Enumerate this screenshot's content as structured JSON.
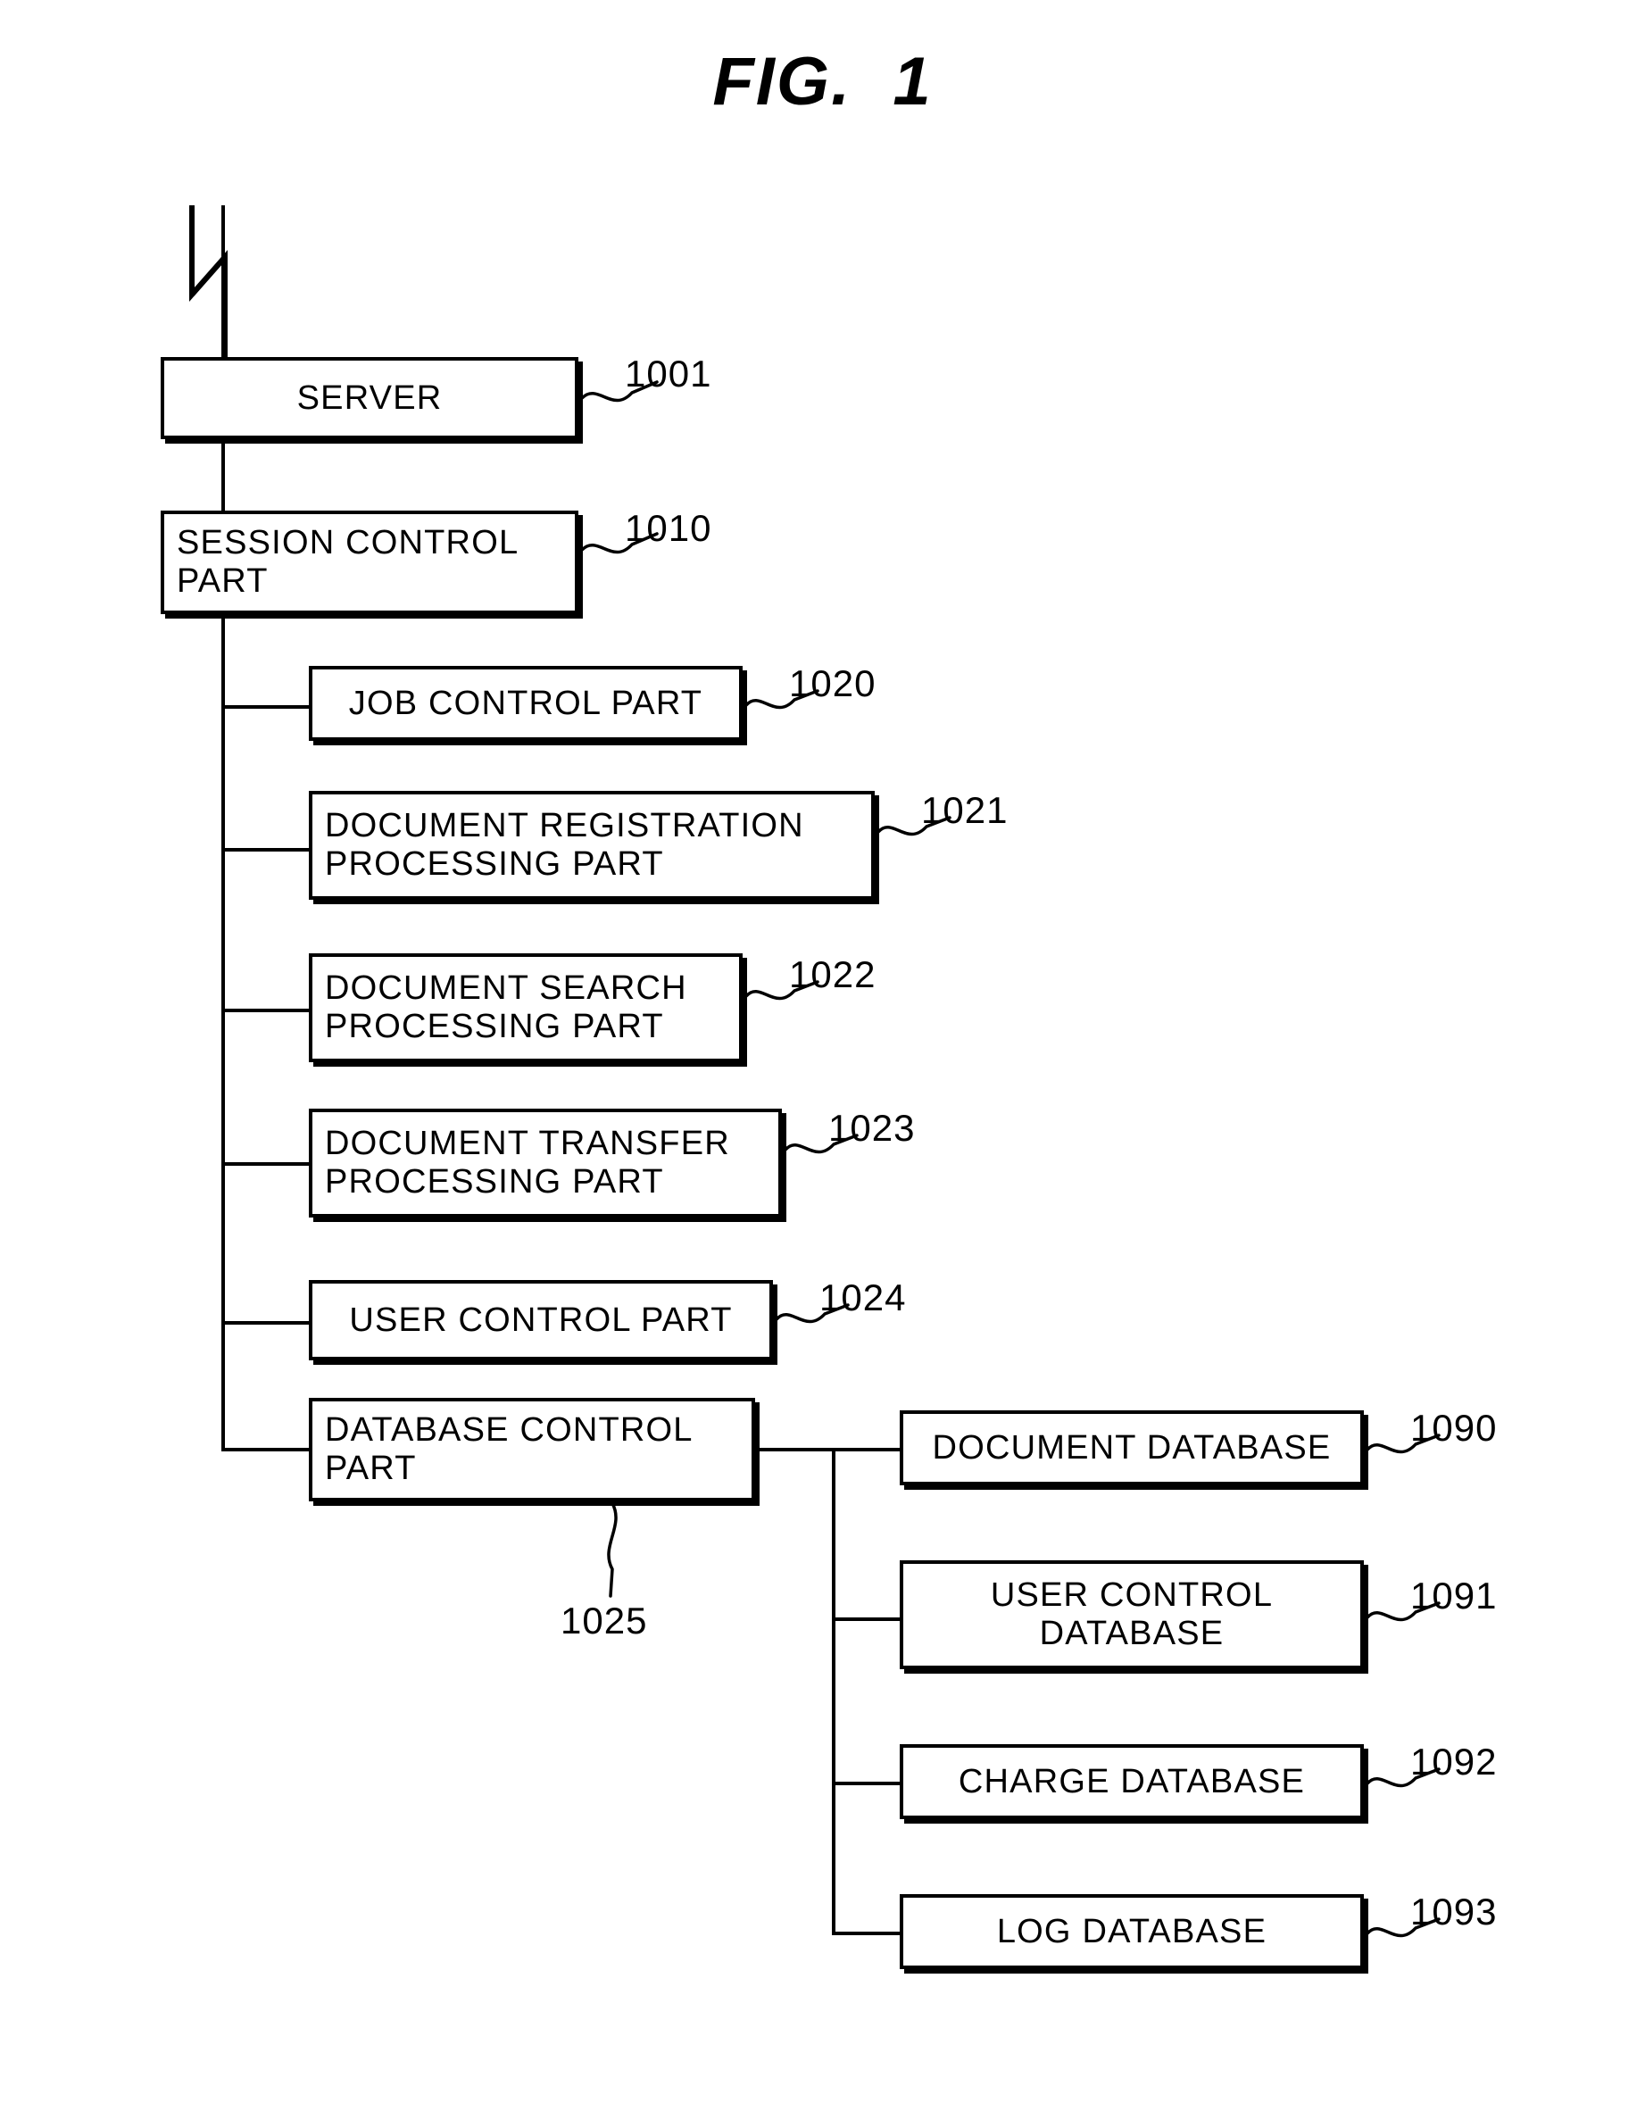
{
  "figure": {
    "title": "FIG.  1"
  },
  "nodes": {
    "server": {
      "label": "SERVER",
      "ref": "1001"
    },
    "session_control": {
      "label": "SESSION CONTROL\nPART",
      "ref": "1010"
    },
    "job_control": {
      "label": "JOB CONTROL PART",
      "ref": "1020"
    },
    "doc_registration": {
      "label": "DOCUMENT REGISTRATION\nPROCESSING PART",
      "ref": "1021"
    },
    "doc_search": {
      "label": "DOCUMENT SEARCH\nPROCESSING PART",
      "ref": "1022"
    },
    "doc_transfer": {
      "label": "DOCUMENT TRANSFER\nPROCESSING PART",
      "ref": "1023"
    },
    "user_control": {
      "label": "USER CONTROL PART",
      "ref": "1024"
    },
    "database_control": {
      "label": "DATABASE CONTROL\nPART",
      "ref": "1025"
    },
    "document_database": {
      "label": "DOCUMENT DATABASE",
      "ref": "1090"
    },
    "user_control_database": {
      "label": "USER CONTROL\nDATABASE",
      "ref": "1091"
    },
    "charge_database": {
      "label": "CHARGE DATABASE",
      "ref": "1092"
    },
    "log_database": {
      "label": "LOG DATABASE",
      "ref": "1093"
    }
  },
  "icons": {
    "network_break": "network-break-icon"
  },
  "colors": {
    "ink": "#000000",
    "paper": "#ffffff"
  }
}
